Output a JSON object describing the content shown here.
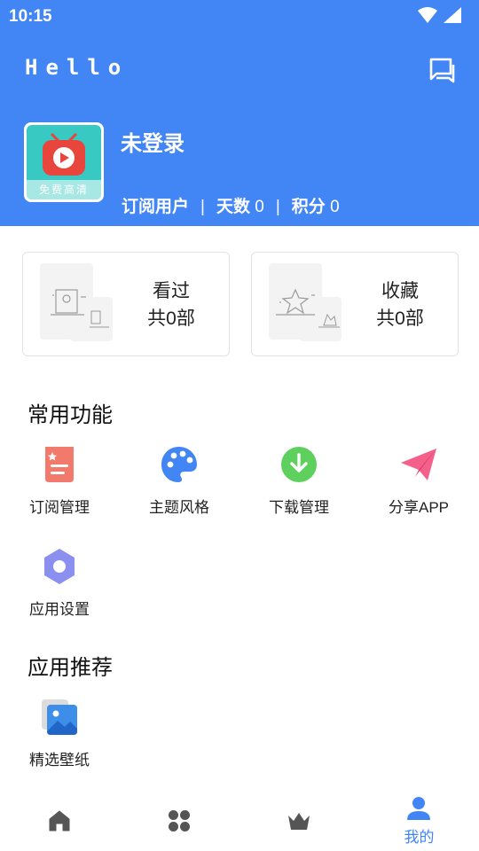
{
  "status_bar": {
    "time": "10:15",
    "icons": [
      "wifi-icon",
      "signal-icon"
    ]
  },
  "header": {
    "title": "Hello",
    "message_icon": "chat-icon",
    "background": "#4285f4"
  },
  "profile": {
    "avatar_caption": "免费高清",
    "username": "未登录",
    "subscription_label": "订阅用户",
    "days_label": "天数",
    "days_value": "0",
    "points_label": "积分",
    "points_value": "0",
    "separator": "|"
  },
  "cards": [
    {
      "title": "看过",
      "count": "共0部"
    },
    {
      "title": "收藏",
      "count": "共0部"
    }
  ],
  "sections": {
    "common": {
      "title": "常用功能",
      "items": [
        {
          "label": "订阅管理",
          "icon": "subscription-icon",
          "color": "#f27a6c"
        },
        {
          "label": "主题风格",
          "icon": "palette-icon",
          "color": "#4285f4"
        },
        {
          "label": "下载管理",
          "icon": "download-icon",
          "color": "#5ed05e"
        },
        {
          "label": "分享APP",
          "icon": "paper-plane-icon",
          "color": "#f4608a"
        },
        {
          "label": "应用设置",
          "icon": "gear-icon",
          "color": "#8b8ff0"
        }
      ]
    },
    "recommend": {
      "title": "应用推荐",
      "items": [
        {
          "label": "精选壁纸",
          "icon": "wallpaper-icon",
          "color": "#3c8ee8"
        }
      ]
    }
  },
  "bottom_nav": {
    "items": [
      {
        "icon": "home-icon",
        "label": ""
      },
      {
        "icon": "grid-icon",
        "label": ""
      },
      {
        "icon": "crown-icon",
        "label": ""
      },
      {
        "icon": "person-icon",
        "label": "我的",
        "active": true
      }
    ],
    "active_color": "#4285f4",
    "inactive_color": "#555555"
  }
}
